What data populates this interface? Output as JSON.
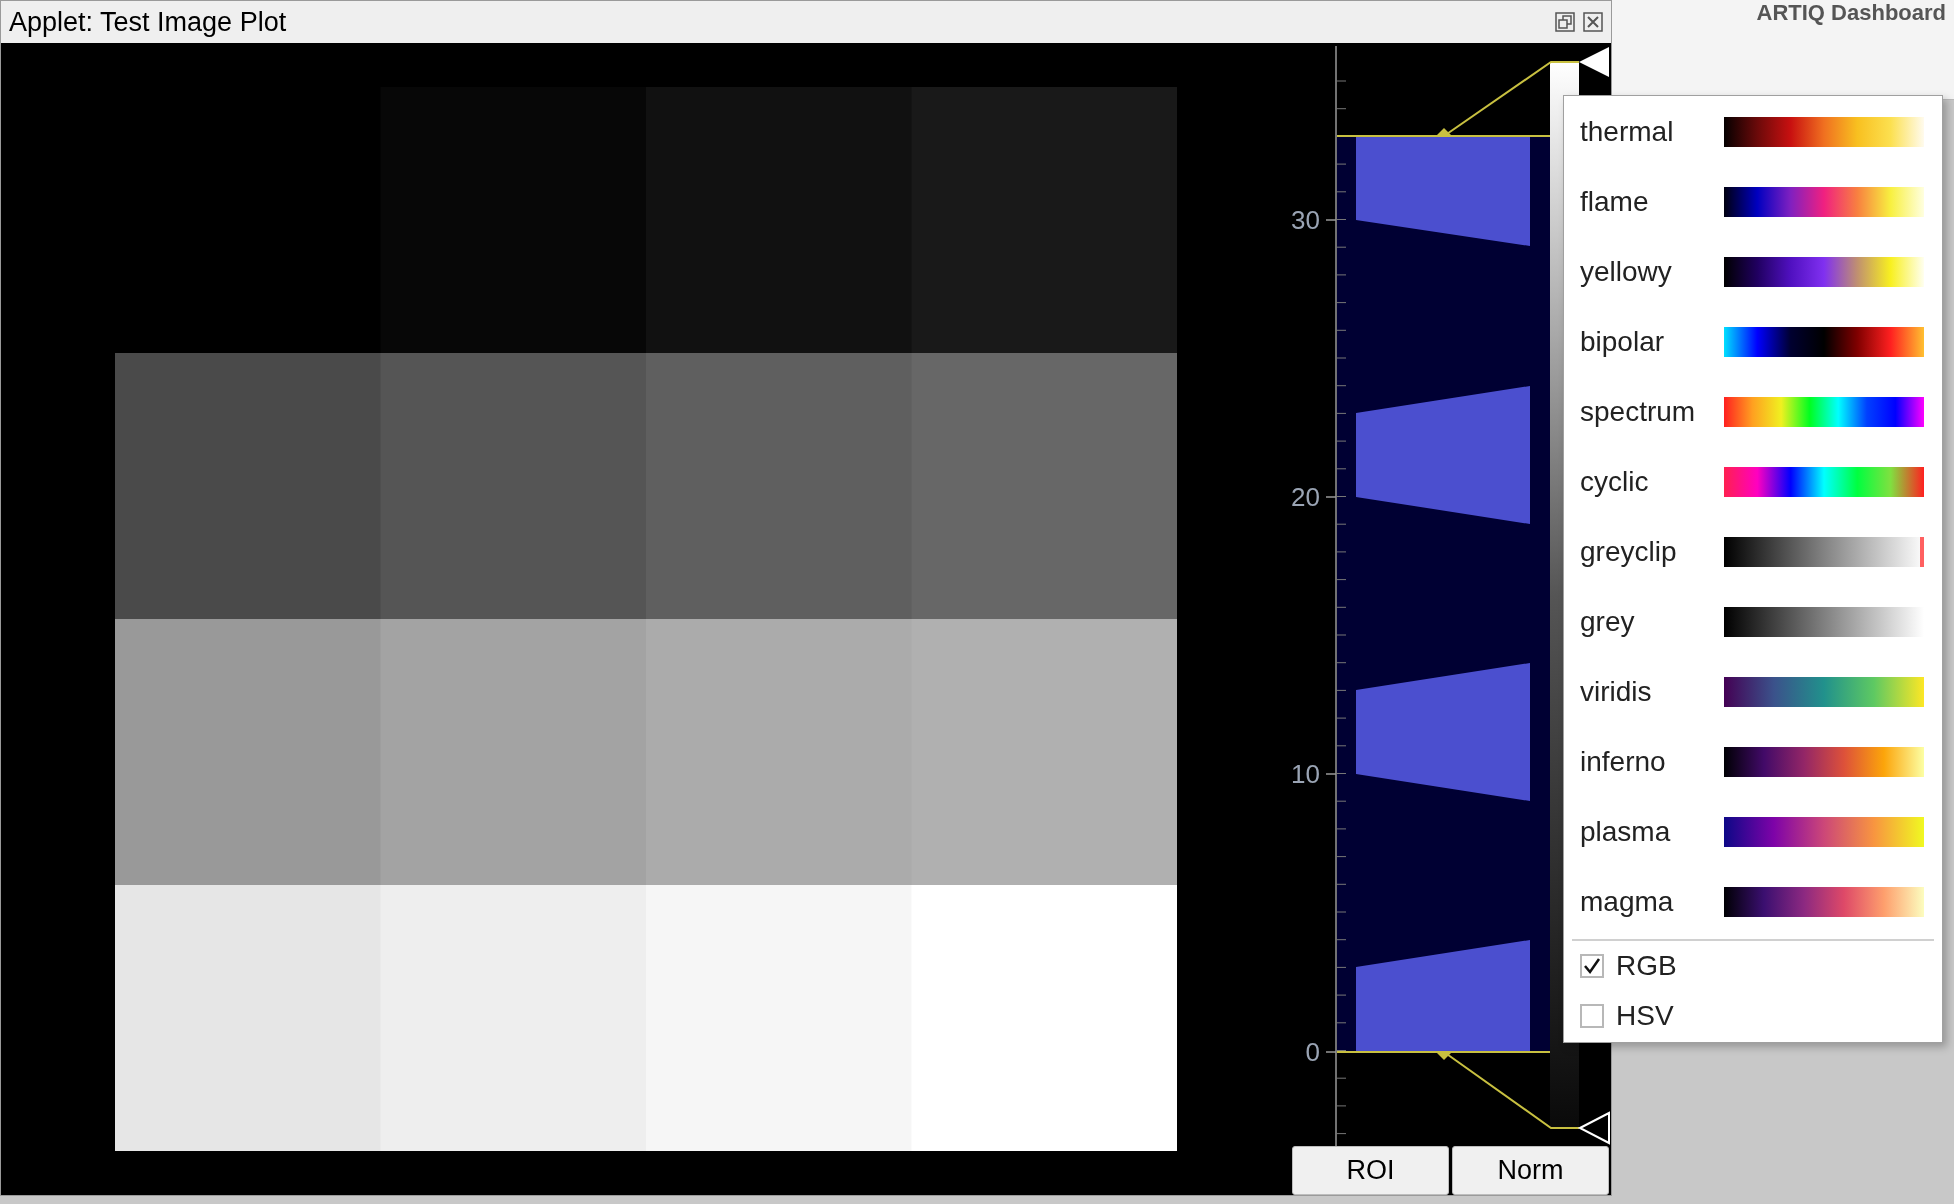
{
  "background_window": {
    "title": "ARTIQ Dashboard"
  },
  "window": {
    "title": "Applet: Test Image Plot"
  },
  "histogram": {
    "axis_labels": [
      "30",
      "20",
      "10",
      "0"
    ]
  },
  "buttons": [
    "ROI",
    "Norm"
  ],
  "colormap_menu": {
    "colormaps": [
      {
        "name": "thermal"
      },
      {
        "name": "flame"
      },
      {
        "name": "yellowy"
      },
      {
        "name": "bipolar"
      },
      {
        "name": "spectrum"
      },
      {
        "name": "cyclic"
      },
      {
        "name": "greyclip"
      },
      {
        "name": "grey"
      },
      {
        "name": "viridis"
      },
      {
        "name": "inferno"
      },
      {
        "name": "plasma"
      },
      {
        "name": "magma"
      }
    ],
    "options": [
      {
        "label": "RGB",
        "checked": true
      },
      {
        "label": "HSV",
        "checked": false
      }
    ]
  }
}
